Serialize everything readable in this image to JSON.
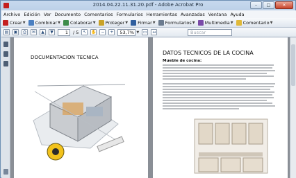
{
  "window": {
    "title": "2014.04.22.11.31.20.pdf - Adobe Acrobat Pro"
  },
  "menu": [
    "Archivo",
    "Edición",
    "Ver",
    "Documento",
    "Comentarios",
    "Formularios",
    "Herramientas",
    "Avanzadas",
    "Ventana",
    "Ayuda"
  ],
  "toolbar": {
    "crear": "Crear",
    "combinar": "Combinar",
    "colaborar": "Colaborar",
    "proteger": "Proteger",
    "firmar": "Firmar",
    "formularios": "Formularios",
    "multimedia": "Multimedia",
    "comentario": "Comentario"
  },
  "nav": {
    "page_current": "1",
    "page_total": "/ 5",
    "zoom": "53,7%",
    "search_placeholder": "Buscar"
  },
  "doc": {
    "page1_title": "DOCUMENTACION TECNICA",
    "page2_title": "DATOS TECNICOS DE LA COCINA",
    "page2_subtitle": "Mueble de cocina:"
  },
  "colors": {
    "accent": "#2f5e9e",
    "pdf_red": "#c41f1f",
    "doc_bg": "#8a8f96"
  },
  "icons": {
    "crear": "create-pdf-icon",
    "combinar": "combine-icon",
    "colaborar": "collaborate-icon",
    "proteger": "lock-icon",
    "firmar": "pen-icon",
    "formularios": "form-icon",
    "multimedia": "media-icon",
    "comentario": "comment-icon"
  }
}
